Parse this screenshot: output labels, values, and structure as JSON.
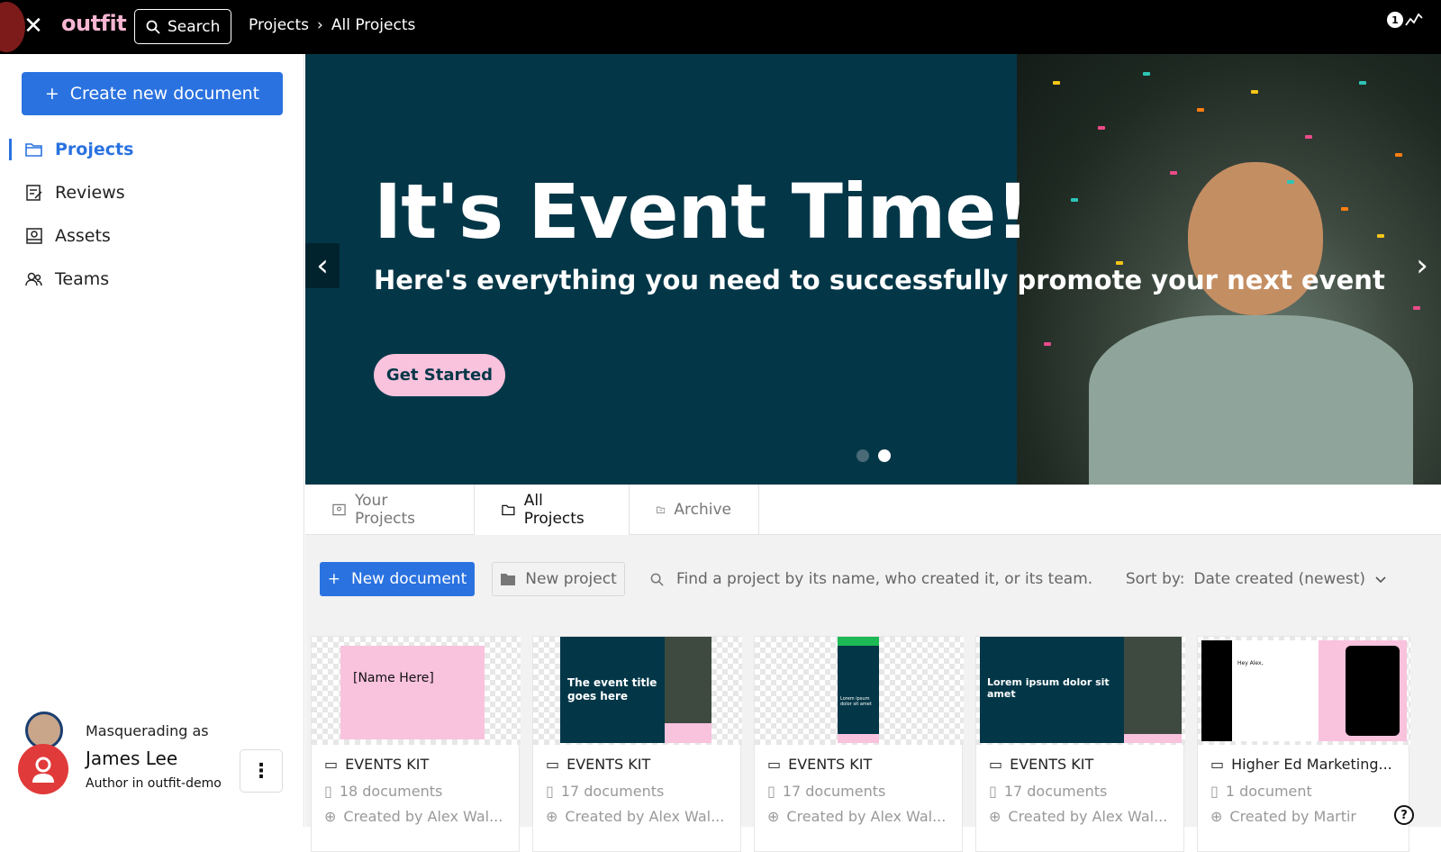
{
  "topbar": {
    "logo": "outfit",
    "search_label": "Search",
    "breadcrumb": [
      "Projects",
      "›",
      "All Projects"
    ],
    "notification_count": "1"
  },
  "sidebar": {
    "create_label": "Create new document",
    "items": [
      {
        "label": "Projects",
        "icon": "folder-open-icon"
      },
      {
        "label": "Reviews",
        "icon": "reviews-icon"
      },
      {
        "label": "Assets",
        "icon": "assets-icon"
      },
      {
        "label": "Teams",
        "icon": "teams-icon"
      }
    ],
    "user": {
      "masquerading": "Masquerading as",
      "name": "James Lee",
      "role": "Author in outfit-demo"
    }
  },
  "hero": {
    "title": "It's Event Time!",
    "subtitle": "Here's everything you need to successfully promote your next event",
    "cta": "Get Started",
    "slide_count": 2,
    "active_slide": 2
  },
  "tabs": [
    {
      "label": "Your Projects",
      "selected": false
    },
    {
      "label": "All Projects",
      "selected": true
    },
    {
      "label": "Archive",
      "selected": false
    }
  ],
  "toolbar": {
    "new_document": "New document",
    "new_project": "New project",
    "find_placeholder": "Find a project by its name, who created it, or its team.",
    "sort_label": "Sort by:",
    "sort_value": "Date created (newest)"
  },
  "cards": [
    {
      "title": "EVENTS KIT",
      "docs": "18 documents",
      "creator": "Created by Alex Wal...",
      "thumb_text": "[Name Here]"
    },
    {
      "title": "EVENTS KIT",
      "docs": "17 documents",
      "creator": "Created by Alex Wal...",
      "thumb_text": "The event title goes here"
    },
    {
      "title": "EVENTS KIT",
      "docs": "17 documents",
      "creator": "Created by Alex Wal...",
      "thumb_text": "Lorem ipsum dolor sit amet"
    },
    {
      "title": "EVENTS KIT",
      "docs": "17 documents",
      "creator": "Created by Alex Wal...",
      "thumb_text": "Lorem ipsum dolor sit amet"
    },
    {
      "title": "Higher Ed Marketing...",
      "docs": "1 document",
      "creator": "Created by Martir",
      "thumb_text": "Hey Alex,"
    }
  ],
  "colors": {
    "brand_blue": "#2a72e0",
    "hero_bg": "#033748",
    "pink": "#f9c2dd",
    "logo_pink": "#f7b6d2"
  }
}
